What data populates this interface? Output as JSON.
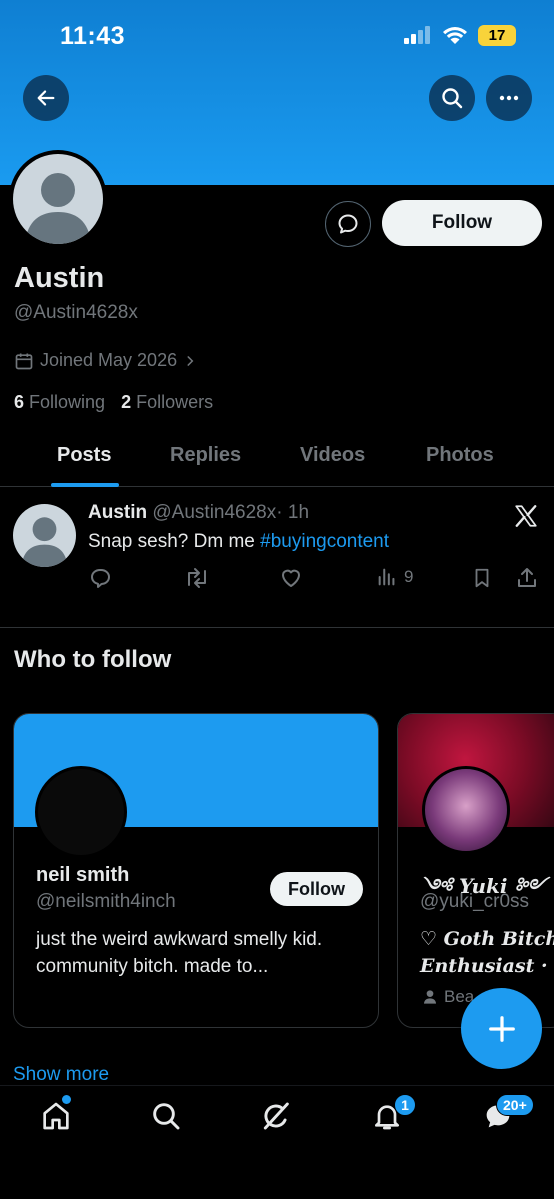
{
  "status_bar": {
    "time": "11:43",
    "battery": "17"
  },
  "header": {
    "back_icon": "arrow-left-icon",
    "search_icon": "search-icon",
    "more_icon": "more-horizontal-icon"
  },
  "profile": {
    "name": "Austin",
    "handle": "@Austin4628x",
    "joined": "Joined May 2026",
    "following_count": "6",
    "following_label": "Following",
    "followers_count": "2",
    "followers_label": "Followers",
    "follow_label": "Follow",
    "message_icon": "message-bubble-icon"
  },
  "tabs": [
    {
      "label": "Posts",
      "active": true
    },
    {
      "label": "Replies",
      "active": false
    },
    {
      "label": "Videos",
      "active": false
    },
    {
      "label": "Photos",
      "active": false
    }
  ],
  "post": {
    "author": "Austin",
    "handle": "@Austin4628x",
    "time": "· 1h",
    "text": "Snap sesh? Dm me ",
    "hashtag": "#buyingcontent",
    "views": "9"
  },
  "who_to_follow": {
    "title": "Who to follow",
    "cards": [
      {
        "name": "neil smith",
        "handle": "@neilsmith4inch",
        "bio": "just the weird awkward smelly kid. community bitch. made to...",
        "follow_label": "Follow"
      },
      {
        "name": "༺ Yuki ༻",
        "handle": "@yuki_cr0ss",
        "bio_line1": "♡ Goth Bitch",
        "bio_line2": "Enthusiast · S",
        "meta": "Bea"
      }
    ],
    "show_more": "Show more"
  },
  "bottom_nav": {
    "notifications_badge": "1",
    "messages_badge": "20+"
  },
  "colors": {
    "accent": "#1d9bf0",
    "background": "#000000",
    "muted": "#71767b"
  }
}
